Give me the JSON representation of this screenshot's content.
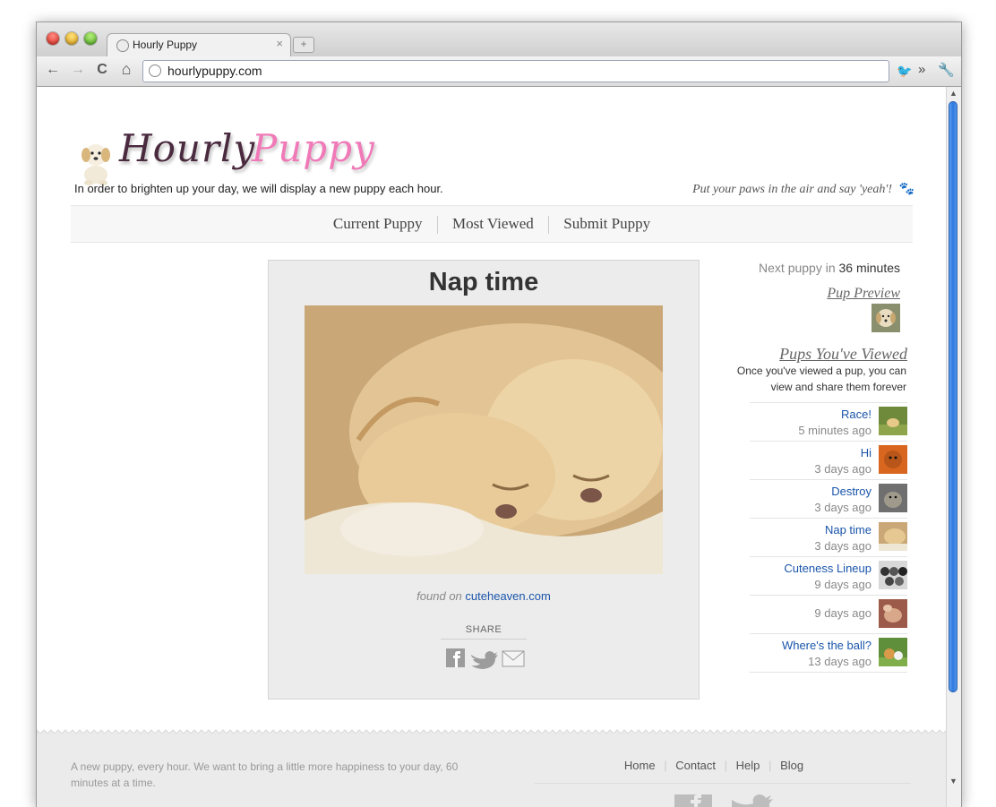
{
  "browser": {
    "tab_title": "Hourly Puppy",
    "tab_close": "×",
    "new_tab": "+",
    "url": "hourlypuppy.com",
    "back": "←",
    "forward": "→",
    "reload": "C",
    "home": "⌂",
    "extension_twitter": "🐦",
    "overflow": "»",
    "wrench": "🔧"
  },
  "site": {
    "logo_hourly": "Hourly",
    "logo_puppy": "Puppy",
    "tagline": "In order to brighten up your day, we will display a new puppy each hour.",
    "motto": "Put your paws in the air and say 'yeah'!",
    "motto_icon": "🐾"
  },
  "nav": {
    "items": [
      "Current Puppy",
      "Most Viewed",
      "Submit Puppy"
    ]
  },
  "main": {
    "title": "Nap time",
    "found_on_label": "found on",
    "found_on_source": "cuteheaven.com",
    "share_label": "SHARE"
  },
  "sidebar": {
    "next_puppy_prefix": "Next puppy in",
    "next_puppy_value": "36 minutes",
    "pup_preview": "Pup Preview",
    "pups_viewed_title": "Pups You've Viewed",
    "pups_viewed_desc_1": "Once you've viewed a pup, you can",
    "pups_viewed_desc_2": "view and share them forever",
    "viewed": [
      {
        "name": "Race!",
        "time": "5 minutes ago"
      },
      {
        "name": "Hi",
        "time": "3 days ago"
      },
      {
        "name": "Destroy",
        "time": "3 days ago"
      },
      {
        "name": "Nap time",
        "time": "3 days ago"
      },
      {
        "name": "Cuteness Lineup",
        "time": "9 days ago"
      },
      {
        "name": "",
        "time": "9 days ago"
      },
      {
        "name": "Where's the ball?",
        "time": "13 days ago"
      }
    ]
  },
  "footer": {
    "text": "A new puppy, every hour. We want to bring a little more happiness to your day, 60 minutes at a time.",
    "links": [
      "Home",
      "Contact",
      "Help",
      "Blog"
    ]
  },
  "colors": {
    "link": "#1a55aa",
    "logo_pink": "#f07ab8",
    "logo_dark": "#4a2a3e"
  }
}
